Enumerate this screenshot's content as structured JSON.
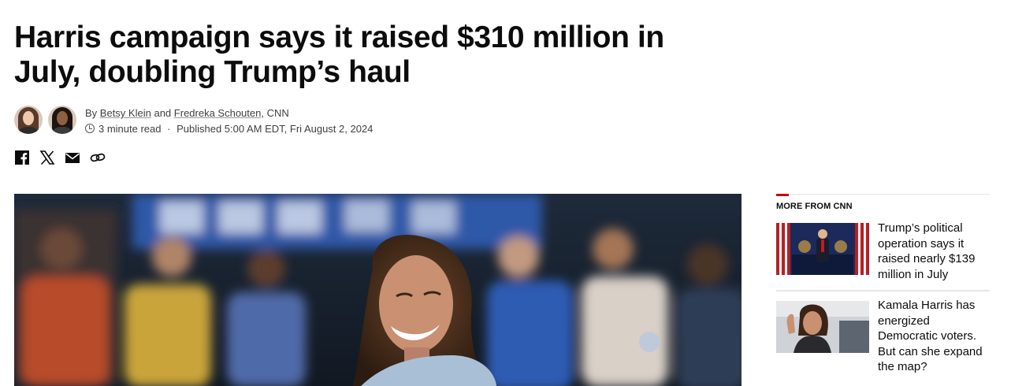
{
  "article": {
    "headline": "Harris campaign says it raised $310 million in July, doubling Trump’s haul",
    "byline": {
      "prefix": "By",
      "author1": "Betsy Klein",
      "conjunction": "and",
      "author2": "Fredreka Schouten",
      "outlet": ", CNN"
    },
    "meta": {
      "read_time": "3 minute read",
      "separator": "·",
      "published": "Published 5:00 AM EDT, Fri August 2, 2024"
    },
    "share_icons": [
      "facebook-icon",
      "x-icon",
      "email-icon",
      "copy-link-icon"
    ]
  },
  "sidebar": {
    "title": "MORE FROM CNN",
    "items": [
      {
        "title": "Trump’s political operation says it raised nearly $139 million in July"
      },
      {
        "title": "Kamala Harris has energized Democratic voters. But can she expand the map?"
      }
    ]
  },
  "colors": {
    "accent": "#cc0000",
    "text": "#0c0c0c",
    "meta": "#404040"
  }
}
